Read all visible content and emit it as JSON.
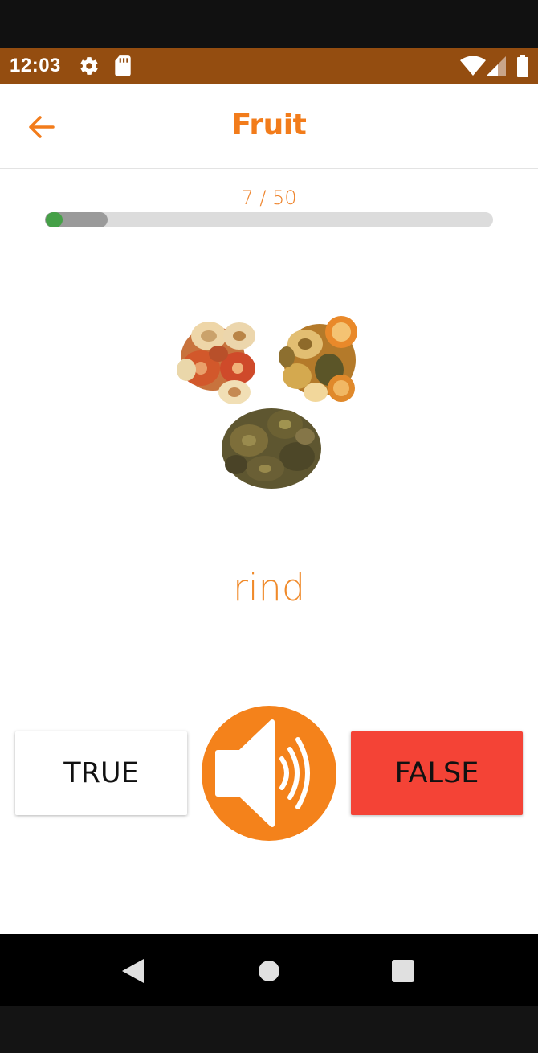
{
  "status_bar": {
    "time": "12:03",
    "background": "#944d10",
    "icons": [
      "gear-icon",
      "sd-card-icon",
      "wifi-icon",
      "signal-icon",
      "battery-icon"
    ]
  },
  "app_bar": {
    "title": "Fruit",
    "back_icon": "arrow-left-icon",
    "accent": "#f27c1b"
  },
  "quiz": {
    "progress_text": "7 / 50",
    "progress_current": 7,
    "progress_total": 50,
    "image": "dried-fruit-slices",
    "word": "rind"
  },
  "buttons": {
    "true_label": "TRUE",
    "false_label": "FALSE",
    "speaker_icon": "speaker-icon",
    "false_color": "#f44336",
    "speaker_color": "#f4821b"
  },
  "nav_bar": {
    "icons": [
      "back-triangle-icon",
      "home-circle-icon",
      "recents-square-icon"
    ]
  }
}
